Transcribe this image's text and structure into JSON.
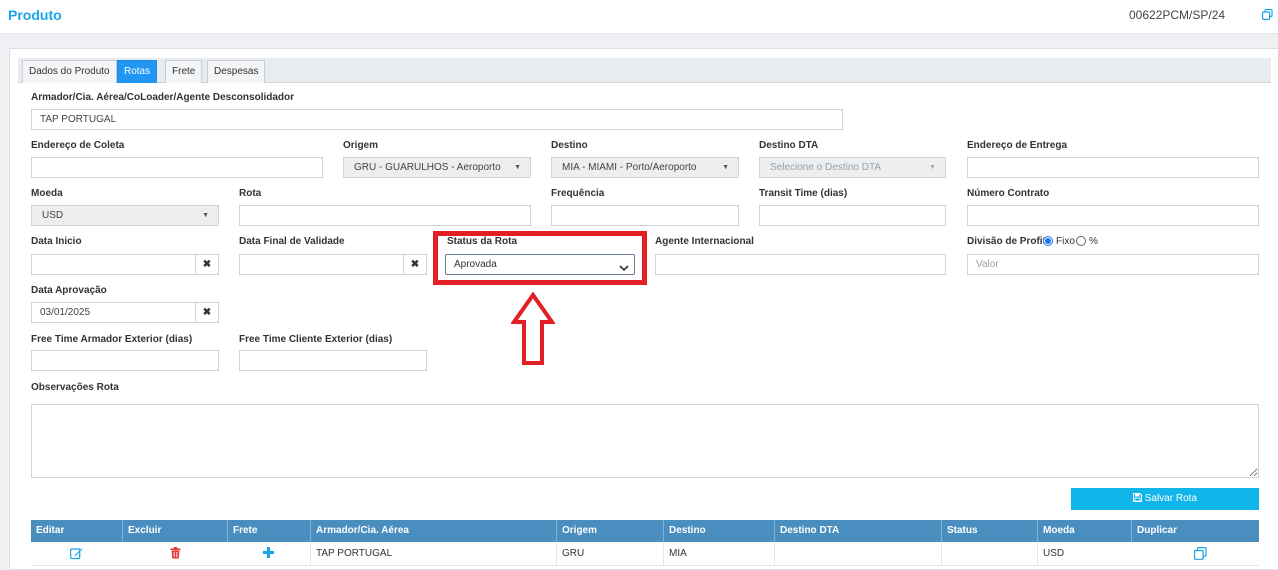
{
  "header": {
    "title": "Produto",
    "reference": "00622PCM/SP/24"
  },
  "tabs": [
    {
      "label": "Dados do Produto",
      "active": false
    },
    {
      "label": "Rotas",
      "active": true
    },
    {
      "label": "Frete",
      "active": false
    },
    {
      "label": "Despesas",
      "active": false
    }
  ],
  "form": {
    "armador": {
      "label": "Armador/Cia. Aérea/CoLoader/Agente Desconsolidador",
      "value": "TAP PORTUGAL"
    },
    "endereco_coleta": {
      "label": "Endereço de Coleta",
      "value": ""
    },
    "origem": {
      "label": "Origem",
      "value": "GRU - GUARULHOS - Aeroporto"
    },
    "destino": {
      "label": "Destino",
      "value": "MIA - MIAMI - Porto/Aeroporto"
    },
    "destino_dta": {
      "label": "Destino DTA",
      "placeholder": "Selecione o Destino DTA"
    },
    "endereco_entrega": {
      "label": "Endereço de Entrega",
      "value": ""
    },
    "moeda": {
      "label": "Moeda",
      "value": "USD"
    },
    "rota": {
      "label": "Rota",
      "value": ""
    },
    "frequencia": {
      "label": "Frequência",
      "value": ""
    },
    "transit_time": {
      "label": "Transit Time (dias)",
      "value": ""
    },
    "numero_contrato": {
      "label": "Número Contrato",
      "value": ""
    },
    "data_inicio": {
      "label": "Data Inicio",
      "value": ""
    },
    "data_final": {
      "label": "Data Final de Validade",
      "value": ""
    },
    "status_rota": {
      "label": "Status da Rota",
      "value": "Aprovada"
    },
    "agente_internacional": {
      "label": "Agente Internacional",
      "value": ""
    },
    "divisao_profit": {
      "label": "Divisão de Profit",
      "option_fixo": "Fixo",
      "option_pct": "%",
      "selected": "Fixo",
      "placeholder": "Valor"
    },
    "data_aprovacao": {
      "label": "Data Aprovação",
      "value": "03/01/2025"
    },
    "free_time_armador": {
      "label": "Free Time Armador Exterior (dias)",
      "value": ""
    },
    "free_time_cliente": {
      "label": "Free Time Cliente Exterior (dias)",
      "value": ""
    },
    "observacoes": {
      "label": "Observações Rota",
      "value": ""
    },
    "clear_glyph": "✖"
  },
  "save_button": {
    "label": "Salvar Rota"
  },
  "table": {
    "columns": [
      "Editar",
      "Excluir",
      "Frete",
      "Armador/Cia. Aérea",
      "Origem",
      "Destino",
      "Destino DTA",
      "Status",
      "Moeda",
      "Duplicar"
    ],
    "rows": [
      {
        "armador": "TAP PORTUGAL",
        "origem": "GRU",
        "destino": "MIA",
        "destino_dta": "",
        "status": "",
        "moeda": "USD"
      }
    ]
  },
  "colors": {
    "accent": "#1aa4e8",
    "tab_active": "#2196f3",
    "highlight": "#e31e24",
    "table_header": "#4a8ec0",
    "delete": "#e53935"
  }
}
